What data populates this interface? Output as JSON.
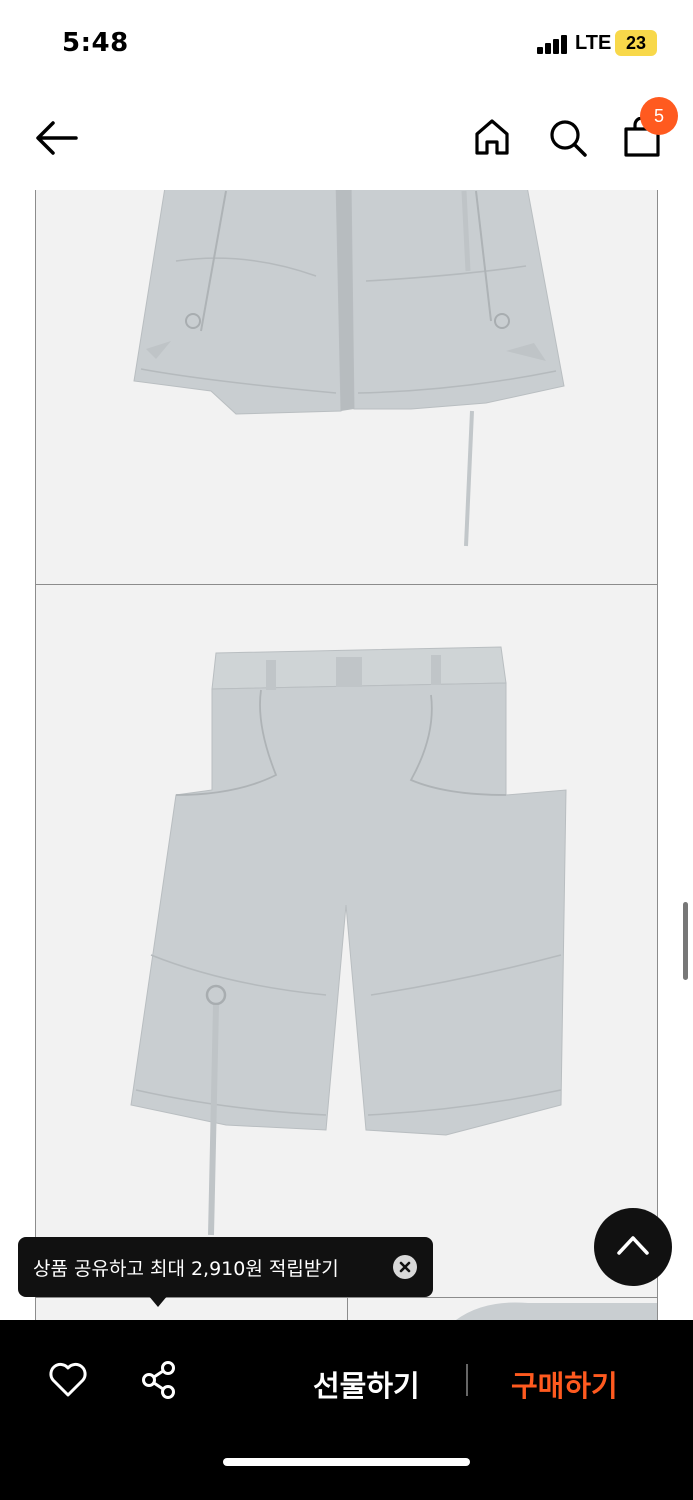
{
  "status_bar": {
    "time": "5:48",
    "network": "LTE",
    "battery": "23"
  },
  "nav": {
    "back_icon": "arrow-left-icon",
    "home_icon": "home-icon",
    "search_icon": "search-icon",
    "cart_icon": "shopping-bag-icon",
    "cart_count": "5"
  },
  "product_images": [
    {
      "view": "front",
      "product": "light gray wide cargo shorts"
    },
    {
      "view": "back",
      "product": "light gray wide cargo shorts"
    }
  ],
  "tooltip": {
    "text": "상품 공유하고 최대 2,910원 적립받기",
    "close_icon": "close-icon"
  },
  "scroll_top_icon": "chevron-up-icon",
  "bottom_bar": {
    "like_icon": "heart-icon",
    "share_icon": "share-icon",
    "gift_label": "선물하기",
    "buy_label": "구매하기"
  },
  "colors": {
    "accent": "#ff5a1f",
    "bar_bg": "#000000",
    "badge": "#ff5a1f",
    "battery": "#f8d84a"
  }
}
